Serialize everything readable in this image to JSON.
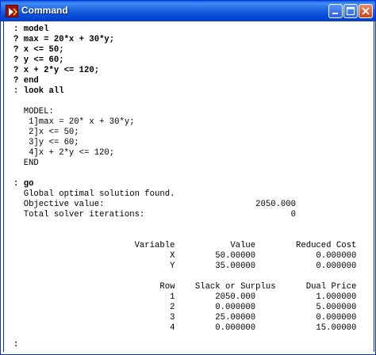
{
  "window": {
    "title": "Command"
  },
  "console": {
    "input_lines": [
      ": model",
      "? max = 20*x + 30*y;",
      "? x <= 50;",
      "? y <= 60;",
      "? x + 2*y <= 120;",
      "? end",
      ": look all"
    ],
    "model_listing": [
      "  MODEL:",
      "   1]max = 20* x + 30*y;",
      "   2]x <= 50;",
      "   3]y <= 60;",
      "   4]x + 2*y <= 120;",
      "  END"
    ],
    "go_command": ": go",
    "solver_output": [
      "  Global optimal solution found.",
      "  Objective value:                              2050.000",
      "  Total solver iterations:                             0"
    ],
    "variable_table": {
      "header": "                        Variable           Value        Reduced Cost",
      "rows": [
        "                               X        50.00000            0.000000",
        "                               Y        35.00000            0.000000"
      ]
    },
    "row_table": {
      "header": "                             Row    Slack or Surplus      Dual Price",
      "rows": [
        "                               1        2050.000            1.000000",
        "                               2        0.000000            5.000000",
        "                               3        25.00000            0.000000",
        "                               4        0.000000            15.00000"
      ]
    },
    "final_prompt": ":"
  },
  "icons": {
    "app": "lingo-app-icon",
    "minimize": "minimize-icon",
    "maximize": "maximize-icon",
    "close": "close-icon"
  }
}
